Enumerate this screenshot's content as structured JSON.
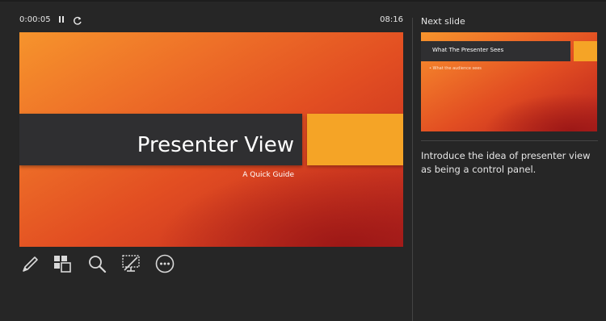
{
  "timer": {
    "elapsed": "0:00:05",
    "pause_icon": "pause-icon",
    "restart_icon": "restart-icon",
    "clock": "08:16"
  },
  "current_slide": {
    "title": "Presenter View",
    "subtitle": "A Quick Guide"
  },
  "toolbar": {
    "tools": [
      "pen-icon",
      "see-all-slides-icon",
      "zoom-icon",
      "black-screen-icon",
      "more-options-icon"
    ]
  },
  "next_slide": {
    "label": "Next slide",
    "title": "What The Presenter Sees",
    "bullet": "What the audience sees"
  },
  "notes": {
    "text": "Introduce the idea of presenter view as being a control panel."
  },
  "colors": {
    "background": "#262626",
    "slide_orange": "#ee7028",
    "slide_red": "#b72520",
    "accent_yellow": "#f5a426",
    "band_dark": "#2f2f31"
  }
}
